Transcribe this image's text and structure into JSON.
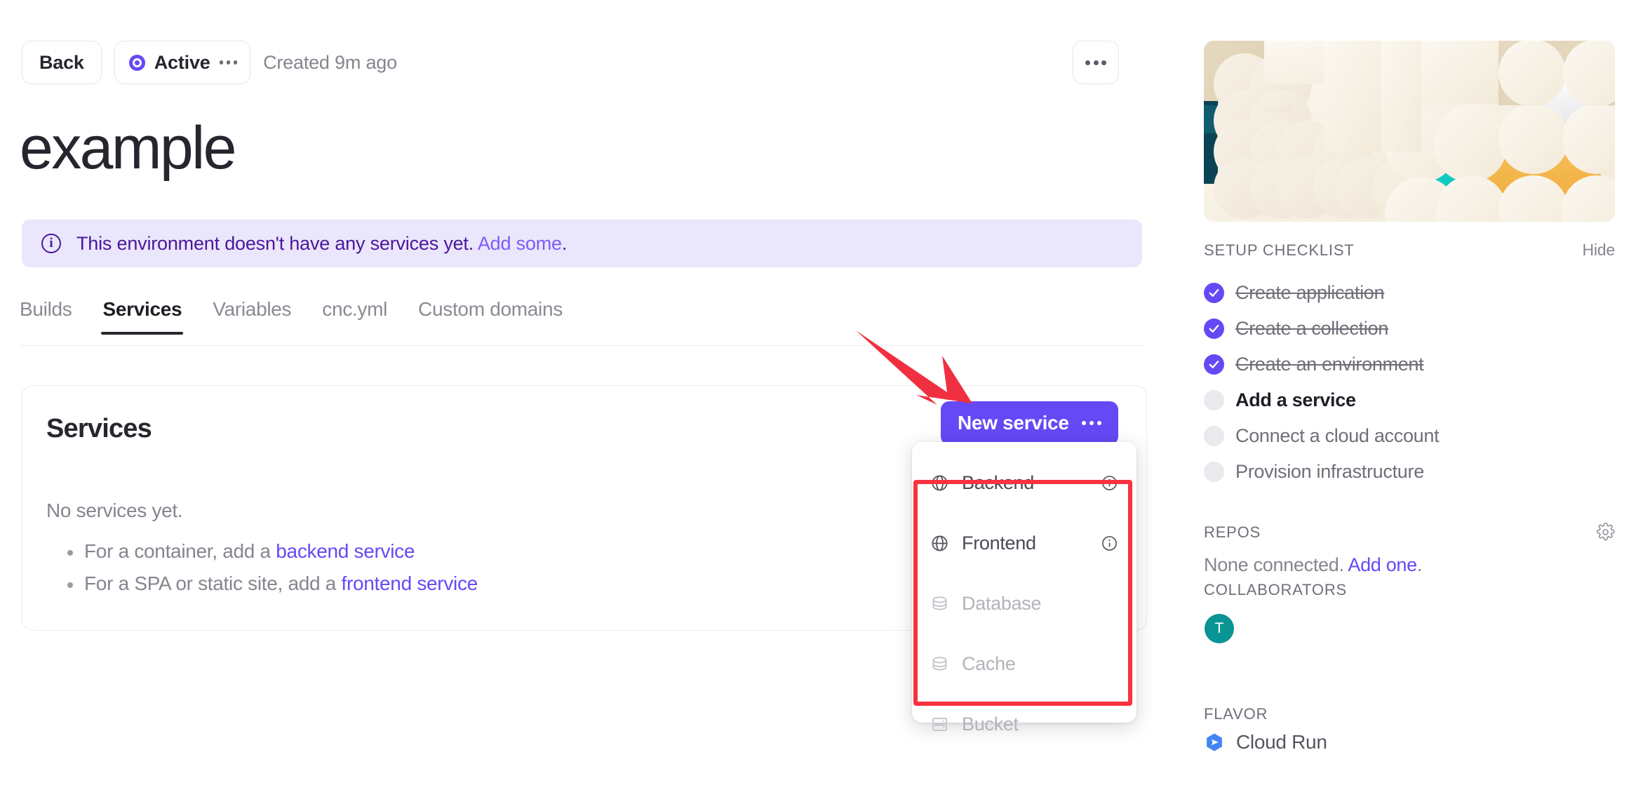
{
  "header": {
    "back_label": "Back",
    "status_label": "Active",
    "status_icon": "radio-target-icon",
    "status_menu_icon": "ellipsis-icon",
    "created_text": "Created 9m ago",
    "more_icon": "ellipsis-icon"
  },
  "title": "example",
  "alert": {
    "icon": "info-circle-icon",
    "message": "This environment doesn't have any services yet.",
    "link": "Add some",
    "period": "."
  },
  "tabs": [
    {
      "label": "Builds",
      "active": false
    },
    {
      "label": "Services",
      "active": true
    },
    {
      "label": "Variables",
      "active": false
    },
    {
      "label": "cnc.yml",
      "active": false
    },
    {
      "label": "Custom domains",
      "active": false
    }
  ],
  "card": {
    "title": "Services",
    "empty_text": "No services yet.",
    "bullets": [
      {
        "prefix": "For a container, add a ",
        "link": "backend service"
      },
      {
        "prefix": "For a SPA or static site, add a ",
        "link": "frontend service"
      }
    ]
  },
  "new_service_button": {
    "label": "New service",
    "menu_icon": "ellipsis-icon",
    "color": "#6549f5"
  },
  "dropdown": {
    "items": [
      {
        "label": "Backend",
        "icon": "globe-icon",
        "info_icon": "info-circle-icon",
        "disabled": false,
        "has_info": true
      },
      {
        "label": "Frontend",
        "icon": "globe-icon",
        "info_icon": "info-circle-icon",
        "disabled": false,
        "has_info": true
      },
      {
        "label": "Database",
        "icon": "database-icon",
        "disabled": true,
        "has_info": false
      },
      {
        "label": "Cache",
        "icon": "database-icon",
        "disabled": true,
        "has_info": false
      },
      {
        "label": "Bucket",
        "icon": "bucket-storage-icon",
        "disabled": true,
        "has_info": false
      }
    ],
    "highlight_color": "#f8323f"
  },
  "annotation": {
    "arrow_icon": "red-arrow-icon",
    "color": "#f03040"
  },
  "sidebar": {
    "hero_icon": "decorative-pattern-banner",
    "checklist": {
      "title": "SETUP CHECKLIST",
      "hide_label": "Hide",
      "items": [
        {
          "label": "Create application",
          "done": true,
          "current": false
        },
        {
          "label": "Create a collection",
          "done": true,
          "current": false
        },
        {
          "label": "Create an environment",
          "done": true,
          "current": false
        },
        {
          "label": "Add a service",
          "done": false,
          "current": true
        },
        {
          "label": "Connect a cloud account",
          "done": false,
          "current": false
        },
        {
          "label": "Provision infrastructure",
          "done": false,
          "current": false
        }
      ]
    },
    "repos": {
      "title": "REPOS",
      "gear_icon": "gear-icon",
      "empty_text": "None connected. ",
      "link": "Add one",
      "period": "."
    },
    "collaborators": {
      "title": "COLLABORATORS",
      "avatars": [
        {
          "initial": "T",
          "color": "#0a9494"
        }
      ]
    },
    "flavor": {
      "title": "FLAVOR",
      "icon": "cloud-run-icon",
      "name": "Cloud Run"
    }
  }
}
